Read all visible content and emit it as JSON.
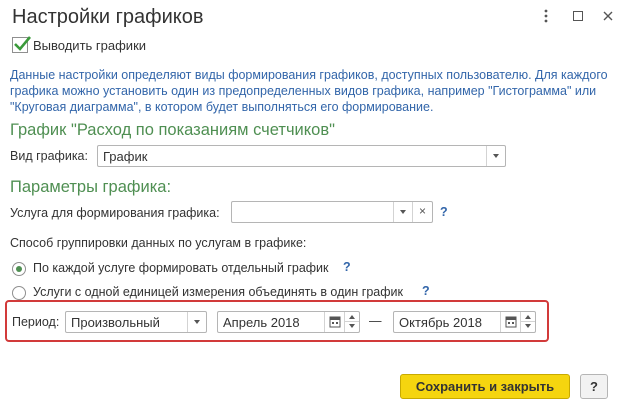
{
  "window": {
    "title": "Настройки графиков",
    "more_icon": "more-vertical-icon",
    "maximize_icon": "maximize-icon",
    "close_icon": "close-icon"
  },
  "show_charts": {
    "label": "Выводить графики",
    "checked": true
  },
  "description": "Данные настройки определяют виды формирования графиков, доступных пользователю. Для каждого графика можно установить один из предопределенных видов графика, например \"Гистограмма\" или \"Круговая диаграмма\", в котором будет выполняться его формирование.",
  "chart_section": {
    "title": "График \"Расход по показаниям счетчиков\"",
    "type_label": "Вид графика:",
    "type_value": "График"
  },
  "params_section": {
    "title": "Параметры графика:",
    "service_label": "Услуга для формирования графика:",
    "service_value": "",
    "clear_glyph": "×",
    "help_glyph": "?"
  },
  "grouping": {
    "label": "Способ группировки данных по услугам в графике:",
    "options": [
      {
        "label": "По каждой услуге формировать отдельный график",
        "selected": true
      },
      {
        "label": "Услуги с одной единицей измерения объединять в один график",
        "selected": false
      }
    ]
  },
  "period": {
    "label": "Период:",
    "type_value": "Произвольный",
    "from": "Апрель 2018",
    "separator": "—",
    "to": "Октябрь 2018"
  },
  "footer": {
    "save_label": "Сохранить и закрыть",
    "help_label": "?"
  },
  "colors": {
    "section_green": "#4f8f52",
    "description_blue": "#3366aa",
    "highlight_red": "#d23a3a",
    "primary_button": "#f5d50f"
  }
}
